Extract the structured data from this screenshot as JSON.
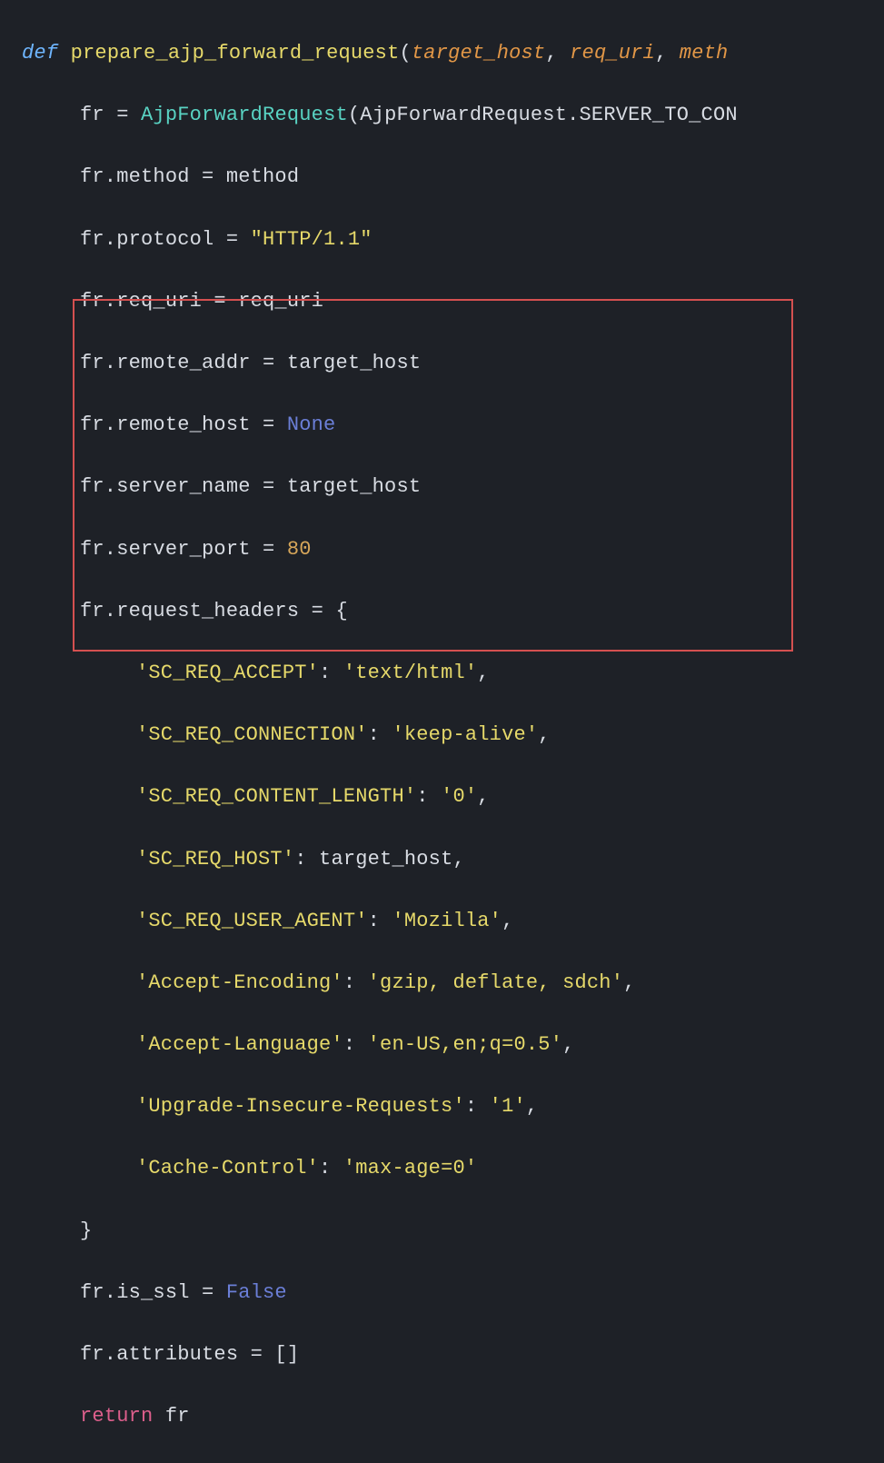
{
  "code": {
    "def": "def",
    "fn": "prepare_ajp_forward_request",
    "p1": "target_host",
    "p2": "req_uri",
    "p3": "meth",
    "l2_a": "fr",
    "l2_eq": " = ",
    "l2_cls": "AjpForwardRequest",
    "l2_paren": "(AjpForwardRequest.SERVER_TO_CON",
    "l3": "fr.method = method",
    "l4_a": "fr.protocol = ",
    "l4_s": "\"HTTP/1.1\"",
    "l5": "fr.req_uri = req_uri",
    "l6": "fr.remote_addr = target_host",
    "l7_a": "fr.remote_host = ",
    "l7_b": "None",
    "l8": "fr.server_name = target_host",
    "l9_a": "fr.server_port = ",
    "l9_b": "80",
    "l10": "fr.request_headers = {",
    "h1k": "'SC_REQ_ACCEPT'",
    "h1c": ": ",
    "h1v": "'text/html'",
    "comma": ",",
    "h2k": "'SC_REQ_CONNECTION'",
    "h2v": "'keep-alive'",
    "h3k": "'SC_REQ_CONTENT_LENGTH'",
    "h3v": "'0'",
    "h4k": "'SC_REQ_HOST'",
    "h4v": "target_host",
    "h5k": "'SC_REQ_USER_AGENT'",
    "h5v": "'Mozilla'",
    "h6k": "'Accept-Encoding'",
    "h6v": "'gzip, deflate, sdch'",
    "h7k": "'Accept-Language'",
    "h7v": "'en-US,en;q=0.5'",
    "h8k": "'Upgrade-Insecure-Requests'",
    "h8v": "'1'",
    "h9k": "'Cache-Control'",
    "h9v": "'max-age=0'",
    "l20": "}",
    "l21_a": "fr.is_ssl = ",
    "l21_b": "False",
    "l22": "fr.attributes = []",
    "l23_a": "return",
    "l23_b": " fr"
  }
}
